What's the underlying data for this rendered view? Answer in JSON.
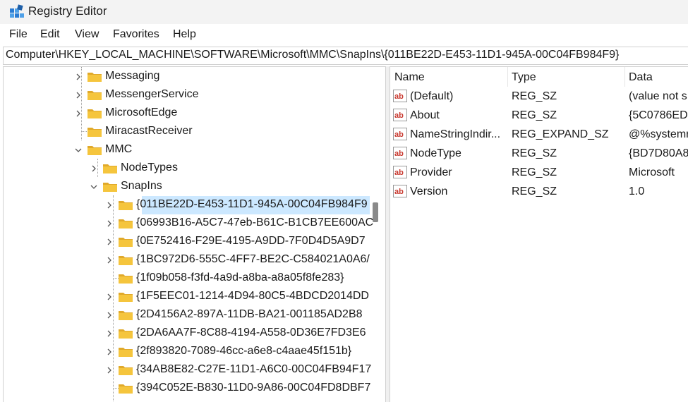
{
  "window": {
    "title": "Registry Editor"
  },
  "menu": [
    "File",
    "Edit",
    "View",
    "Favorites",
    "Help"
  ],
  "address": "Computer\\HKEY_LOCAL_MACHINE\\SOFTWARE\\Microsoft\\MMC\\SnapIns\\{011BE22D-E453-11D1-945A-00C04FB984F9}",
  "tree": [
    {
      "label": "Messaging",
      "level": 0,
      "expander": "collapsed"
    },
    {
      "label": "MessengerService",
      "level": 0,
      "expander": "collapsed"
    },
    {
      "label": "MicrosoftEdge",
      "level": 0,
      "expander": "collapsed"
    },
    {
      "label": "MiracastReceiver",
      "level": 0,
      "expander": "none"
    },
    {
      "label": "MMC",
      "level": 0,
      "expander": "expanded"
    },
    {
      "label": "NodeTypes",
      "level": 1,
      "expander": "collapsed"
    },
    {
      "label": "SnapIns",
      "level": 1,
      "expander": "expanded"
    },
    {
      "label": "{011BE22D-E453-11D1-945A-00C04FB984F9",
      "level": 2,
      "expander": "collapsed",
      "selected": true
    },
    {
      "label": "{06993B16-A5C7-47eb-B61C-B1CB7EE600AC",
      "level": 2,
      "expander": "collapsed"
    },
    {
      "label": "{0E752416-F29E-4195-A9DD-7F0D4D5A9D7",
      "level": 2,
      "expander": "collapsed"
    },
    {
      "label": "{1BC972D6-555C-4FF7-BE2C-C584021A0A6/",
      "level": 2,
      "expander": "collapsed"
    },
    {
      "label": "{1f09b058-f3fd-4a9d-a8ba-a8a05f8fe283}",
      "level": 2,
      "expander": "none"
    },
    {
      "label": "{1F5EEC01-1214-4D94-80C5-4BDCD2014DD",
      "level": 2,
      "expander": "collapsed"
    },
    {
      "label": "{2D4156A2-897A-11DB-BA21-001185AD2B8",
      "level": 2,
      "expander": "collapsed"
    },
    {
      "label": "{2DA6AA7F-8C88-4194-A558-0D36E7FD3E6",
      "level": 2,
      "expander": "collapsed"
    },
    {
      "label": "{2f893820-7089-46cc-a6e8-c4aae45f151b}",
      "level": 2,
      "expander": "collapsed"
    },
    {
      "label": "{34AB8E82-C27E-11D1-A6C0-00C04FB94F17",
      "level": 2,
      "expander": "collapsed"
    },
    {
      "label": "{394C052E-B830-11D0-9A86-00C04FD8DBF7",
      "level": 2,
      "expander": "none"
    }
  ],
  "columns": {
    "name": "Name",
    "type": "Type",
    "data": "Data"
  },
  "values": [
    {
      "name": "(Default)",
      "type": "REG_SZ",
      "data": "(value not s"
    },
    {
      "name": "About",
      "type": "REG_SZ",
      "data": "{5C0786ED-"
    },
    {
      "name": "NameStringIndir...",
      "type": "REG_EXPAND_SZ",
      "data": "@%systemr"
    },
    {
      "name": "NodeType",
      "type": "REG_SZ",
      "data": "{BD7D80A8"
    },
    {
      "name": "Provider",
      "type": "REG_SZ",
      "data": "Microsoft"
    },
    {
      "name": "Version",
      "type": "REG_SZ",
      "data": "1.0"
    }
  ],
  "colors": {
    "selection": "#cce8ff",
    "folder": "#f5c53d",
    "folder_dark": "#e0a92b",
    "ab_red": "#c8372d"
  }
}
